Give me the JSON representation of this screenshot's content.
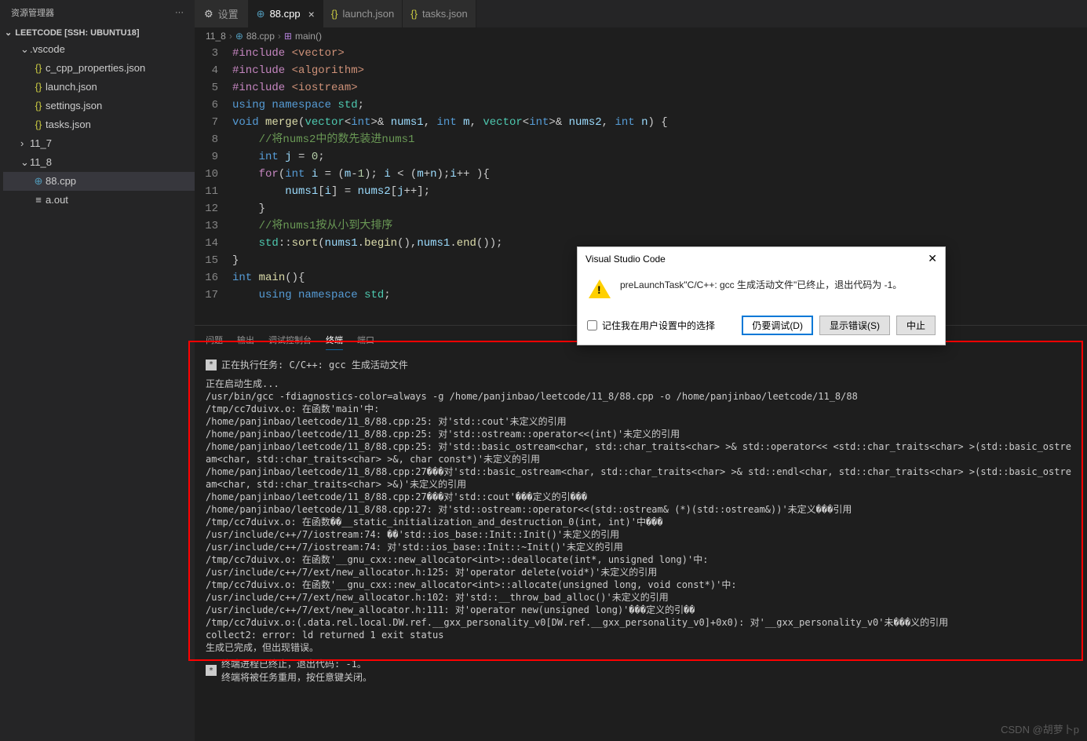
{
  "sidebar": {
    "title": "资源管理器",
    "more": "···",
    "workspace": "LEETCODE [SSH: UBUNTU18]",
    "items": [
      {
        "icon": "chev",
        "label": ".vscode",
        "indent": 0,
        "open": true
      },
      {
        "icon": "json",
        "label": "c_cpp_properties.json",
        "indent": 1
      },
      {
        "icon": "json",
        "label": "launch.json",
        "indent": 1
      },
      {
        "icon": "json",
        "label": "settings.json",
        "indent": 1
      },
      {
        "icon": "json",
        "label": "tasks.json",
        "indent": 1
      },
      {
        "icon": "folder",
        "label": "11_7",
        "indent": 0,
        "open": false
      },
      {
        "icon": "folder",
        "label": "11_8",
        "indent": 0,
        "open": true
      },
      {
        "icon": "cpp",
        "label": "88.cpp",
        "indent": 1,
        "active": true
      },
      {
        "icon": "out",
        "label": "a.out",
        "indent": 1
      }
    ]
  },
  "tabs": [
    {
      "icon": "gear",
      "label": "设置",
      "active": false
    },
    {
      "icon": "cpp",
      "label": "88.cpp",
      "active": true,
      "close": true
    },
    {
      "icon": "json",
      "label": "launch.json",
      "active": false
    },
    {
      "icon": "json",
      "label": "tasks.json",
      "active": false
    }
  ],
  "breadcrumb": [
    {
      "text": "11_8"
    },
    {
      "text": "88.cpp",
      "icon": "cpp"
    },
    {
      "text": "main()",
      "icon": "fn"
    }
  ],
  "code_lines": [
    {
      "n": 3,
      "html": "<span class='inc'>#include</span> <span class='str'>&lt;vector&gt;</span>"
    },
    {
      "n": 4,
      "html": "<span class='inc'>#include</span> <span class='str'>&lt;algorithm&gt;</span>"
    },
    {
      "n": 5,
      "html": "<span class='inc'>#include</span> <span class='str'>&lt;iostream&gt;</span>"
    },
    {
      "n": 6,
      "html": "<span class='kw'>using</span> <span class='kw'>namespace</span> <span class='ns'>std</span>;"
    },
    {
      "n": 7,
      "html": "<span class='kw'>void</span> <span class='fn'>merge</span>(<span class='type'>vector</span>&lt;<span class='kw'>int</span>&gt;&amp; <span class='var'>nums1</span>, <span class='kw'>int</span> <span class='var'>m</span>, <span class='type'>vector</span>&lt;<span class='kw'>int</span>&gt;&amp; <span class='var'>nums2</span>, <span class='kw'>int</span> <span class='var'>n</span>) {"
    },
    {
      "n": 8,
      "html": "    <span class='comment'>//将nums2中的数先装进nums1</span>"
    },
    {
      "n": 9,
      "html": "    <span class='kw'>int</span> <span class='var'>j</span> = <span class='num'>0</span>;"
    },
    {
      "n": 10,
      "html": "    <span class='inc'>for</span>(<span class='kw'>int</span> <span class='var'>i</span> = (<span class='var'>m</span>-<span class='num'>1</span>); <span class='var'>i</span> &lt; (<span class='var'>m</span>+<span class='var'>n</span>);<span class='var'>i</span>++ ){"
    },
    {
      "n": 11,
      "html": "        <span class='var'>nums1</span>[<span class='var'>i</span>] = <span class='var'>nums2</span>[<span class='var'>j</span>++];"
    },
    {
      "n": 12,
      "html": "    }"
    },
    {
      "n": 13,
      "html": "    <span class='comment'>//将nums1按从小到大排序</span>"
    },
    {
      "n": 14,
      "html": "    <span class='ns'>std</span>::<span class='fn'>sort</span>(<span class='var'>nums1</span>.<span class='fn'>begin</span>(),<span class='var'>nums1</span>.<span class='fn'>end</span>());"
    },
    {
      "n": 15,
      "html": "}"
    },
    {
      "n": 16,
      "html": "<span class='kw'>int</span> <span class='fn'>main</span>(){"
    },
    {
      "n": 17,
      "html": "    <span class='kw'>using</span> <span class='kw'>namespace</span> <span class='ns'>std</span>;"
    }
  ],
  "panel_tabs": [
    "问题",
    "输出",
    "调试控制台",
    "终端",
    "端口"
  ],
  "terminal": {
    "task_label": "正在执行任务: C/C++: gcc 生成活动文件",
    "lines": [
      "正在启动生成...",
      "/usr/bin/gcc -fdiagnostics-color=always -g /home/panjinbao/leetcode/11_8/88.cpp -o /home/panjinbao/leetcode/11_8/88",
      "/tmp/cc7duivx.o: 在函数'main'中:",
      "/home/panjinbao/leetcode/11_8/88.cpp:25: 对'std::cout'未定义的引用",
      "/home/panjinbao/leetcode/11_8/88.cpp:25: 对'std::ostream::operator<<(int)'未定义的引用",
      "/home/panjinbao/leetcode/11_8/88.cpp:25: 对'std::basic_ostream<char, std::char_traits<char> >& std::operator<< <std::char_traits<char> >(std::basic_ostream<char, std::char_traits<char> >&, char const*)'未定义的引用",
      "/home/panjinbao/leetcode/11_8/88.cpp:27���对'std::basic_ostream<char, std::char_traits<char> >& std::endl<char, std::char_traits<char> >(std::basic_ostream<char, std::char_traits<char> >&)'未定义的引用",
      "/home/panjinbao/leetcode/11_8/88.cpp:27���对'std::cout'���定义的引���",
      "/home/panjinbao/leetcode/11_8/88.cpp:27: 对'std::ostream::operator<<(std::ostream& (*)(std::ostream&))'未定义���引用",
      "/tmp/cc7duivx.o: 在函数��__static_initialization_and_destruction_0(int, int)'中���",
      "/usr/include/c++/7/iostream:74: ��'std::ios_base::Init::Init()'未定义的引用",
      "/usr/include/c++/7/iostream:74: 对'std::ios_base::Init::~Init()'未定义的引用",
      "/tmp/cc7duivx.o: 在函数'__gnu_cxx::new_allocator<int>::deallocate(int*, unsigned long)'中:",
      "/usr/include/c++/7/ext/new_allocator.h:125: 对'operator delete(void*)'未定义的引用",
      "/tmp/cc7duivx.o: 在函数'__gnu_cxx::new_allocator<int>::allocate(unsigned long, void const*)'中:",
      "/usr/include/c++/7/ext/new_allocator.h:102: 对'std::__throw_bad_alloc()'未定义的引用",
      "/usr/include/c++/7/ext/new_allocator.h:111: 对'operator new(unsigned long)'���定义的引��",
      "/tmp/cc7duivx.o:(.data.rel.local.DW.ref.__gxx_personality_v0[DW.ref.__gxx_personality_v0]+0x0): 对'__gxx_personality_v0'未���义的引用",
      "collect2: error: ld returned 1 exit status",
      "",
      "生成已完成，但出现错误。"
    ],
    "footer1": "终端进程已终止，退出代码: -1。",
    "footer2": "终端将被任务重用，按任意键关闭。"
  },
  "dialog": {
    "title": "Visual Studio Code",
    "message": "preLaunchTask\"C/C++: gcc 生成活动文件\"已终止，退出代码为 -1。",
    "checkbox": "记住我在用户设置中的选择",
    "buttons": {
      "debug": "仍要调试(D)",
      "errors": "显示错误(S)",
      "abort": "中止"
    }
  },
  "watermark": "CSDN @胡萝卜p"
}
